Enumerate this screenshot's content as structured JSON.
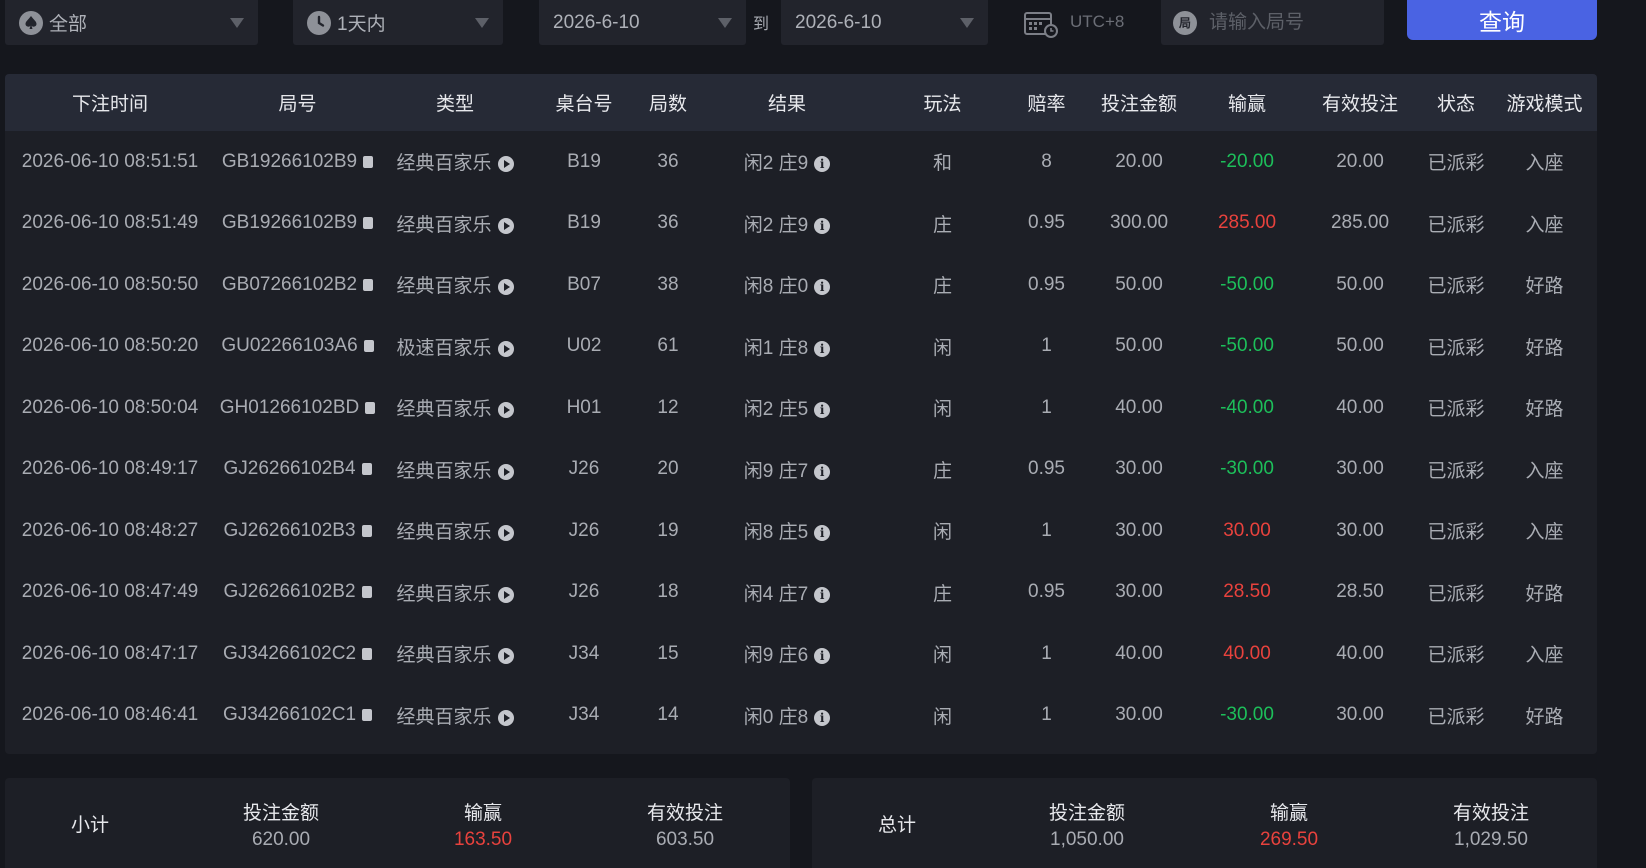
{
  "filters": {
    "game": {
      "label": "全部",
      "icon": "spade-icon"
    },
    "range": {
      "label": "1天内",
      "icon": "clock-icon"
    },
    "date_from": "2026-6-10",
    "to_label": "到",
    "date_to": "2026-6-10",
    "timezone": "UTC+8",
    "round_search": {
      "icon_text": "局",
      "placeholder": "请输入局号",
      "value": ""
    },
    "query_label": "查询"
  },
  "table": {
    "headers": [
      "下注时间",
      "局号",
      "类型",
      "桌台号",
      "局数",
      "结果",
      "玩法",
      "赔率",
      "投注金额",
      "输赢",
      "有效投注",
      "状态",
      "游戏模式"
    ],
    "rows": [
      {
        "time": "2026-06-10 08:51:51",
        "round": "GB19266102B9",
        "type": "经典百家乐",
        "table": "B19",
        "count": "36",
        "result": "闲2 庄9",
        "play": "和",
        "odds": "8",
        "bet": "20.00",
        "winloss": "-20.00",
        "sign": "neg",
        "valid": "20.00",
        "status": "已派彩",
        "mode": "入座"
      },
      {
        "time": "2026-06-10 08:51:49",
        "round": "GB19266102B9",
        "type": "经典百家乐",
        "table": "B19",
        "count": "36",
        "result": "闲2 庄9",
        "play": "庄",
        "odds": "0.95",
        "bet": "300.00",
        "winloss": "285.00",
        "sign": "pos",
        "valid": "285.00",
        "status": "已派彩",
        "mode": "入座"
      },
      {
        "time": "2026-06-10 08:50:50",
        "round": "GB07266102B2",
        "type": "经典百家乐",
        "table": "B07",
        "count": "38",
        "result": "闲8 庄0",
        "play": "庄",
        "odds": "0.95",
        "bet": "50.00",
        "winloss": "-50.00",
        "sign": "neg",
        "valid": "50.00",
        "status": "已派彩",
        "mode": "好路"
      },
      {
        "time": "2026-06-10 08:50:20",
        "round": "GU02266103A6",
        "type": "极速百家乐",
        "table": "U02",
        "count": "61",
        "result": "闲1 庄8",
        "play": "闲",
        "odds": "1",
        "bet": "50.00",
        "winloss": "-50.00",
        "sign": "neg",
        "valid": "50.00",
        "status": "已派彩",
        "mode": "好路"
      },
      {
        "time": "2026-06-10 08:50:04",
        "round": "GH01266102BD",
        "type": "经典百家乐",
        "table": "H01",
        "count": "12",
        "result": "闲2 庄5",
        "play": "闲",
        "odds": "1",
        "bet": "40.00",
        "winloss": "-40.00",
        "sign": "neg",
        "valid": "40.00",
        "status": "已派彩",
        "mode": "好路"
      },
      {
        "time": "2026-06-10 08:49:17",
        "round": "GJ26266102B4",
        "type": "经典百家乐",
        "table": "J26",
        "count": "20",
        "result": "闲9 庄7",
        "play": "庄",
        "odds": "0.95",
        "bet": "30.00",
        "winloss": "-30.00",
        "sign": "neg",
        "valid": "30.00",
        "status": "已派彩",
        "mode": "入座"
      },
      {
        "time": "2026-06-10 08:48:27",
        "round": "GJ26266102B3",
        "type": "经典百家乐",
        "table": "J26",
        "count": "19",
        "result": "闲8 庄5",
        "play": "闲",
        "odds": "1",
        "bet": "30.00",
        "winloss": "30.00",
        "sign": "pos",
        "valid": "30.00",
        "status": "已派彩",
        "mode": "入座"
      },
      {
        "time": "2026-06-10 08:47:49",
        "round": "GJ26266102B2",
        "type": "经典百家乐",
        "table": "J26",
        "count": "18",
        "result": "闲4 庄7",
        "play": "庄",
        "odds": "0.95",
        "bet": "30.00",
        "winloss": "28.50",
        "sign": "pos",
        "valid": "28.50",
        "status": "已派彩",
        "mode": "好路"
      },
      {
        "time": "2026-06-10 08:47:17",
        "round": "GJ34266102C2",
        "type": "经典百家乐",
        "table": "J34",
        "count": "15",
        "result": "闲9 庄6",
        "play": "闲",
        "odds": "1",
        "bet": "40.00",
        "winloss": "40.00",
        "sign": "pos",
        "valid": "40.00",
        "status": "已派彩",
        "mode": "入座"
      },
      {
        "time": "2026-06-10 08:46:41",
        "round": "GJ34266102C1",
        "type": "经典百家乐",
        "table": "J34",
        "count": "14",
        "result": "闲0 庄8",
        "play": "闲",
        "odds": "1",
        "bet": "30.00",
        "winloss": "-30.00",
        "sign": "neg",
        "valid": "30.00",
        "status": "已派彩",
        "mode": "好路"
      }
    ]
  },
  "subtotal": {
    "label": "小计",
    "bet_label": "投注金额",
    "bet": "620.00",
    "winloss_label": "输赢",
    "winloss": "163.50",
    "valid_label": "有效投注",
    "valid": "603.50"
  },
  "total": {
    "label": "总计",
    "bet_label": "投注金额",
    "bet": "1,050.00",
    "winloss_label": "输赢",
    "winloss": "269.50",
    "valid_label": "有效投注",
    "valid": "1,029.50"
  },
  "colors": {
    "accent": "#4a63e3",
    "win": "#e8423d",
    "loss": "#1dbf5a",
    "header_bg": "#262a36",
    "panel_bg": "#1d1f26"
  }
}
